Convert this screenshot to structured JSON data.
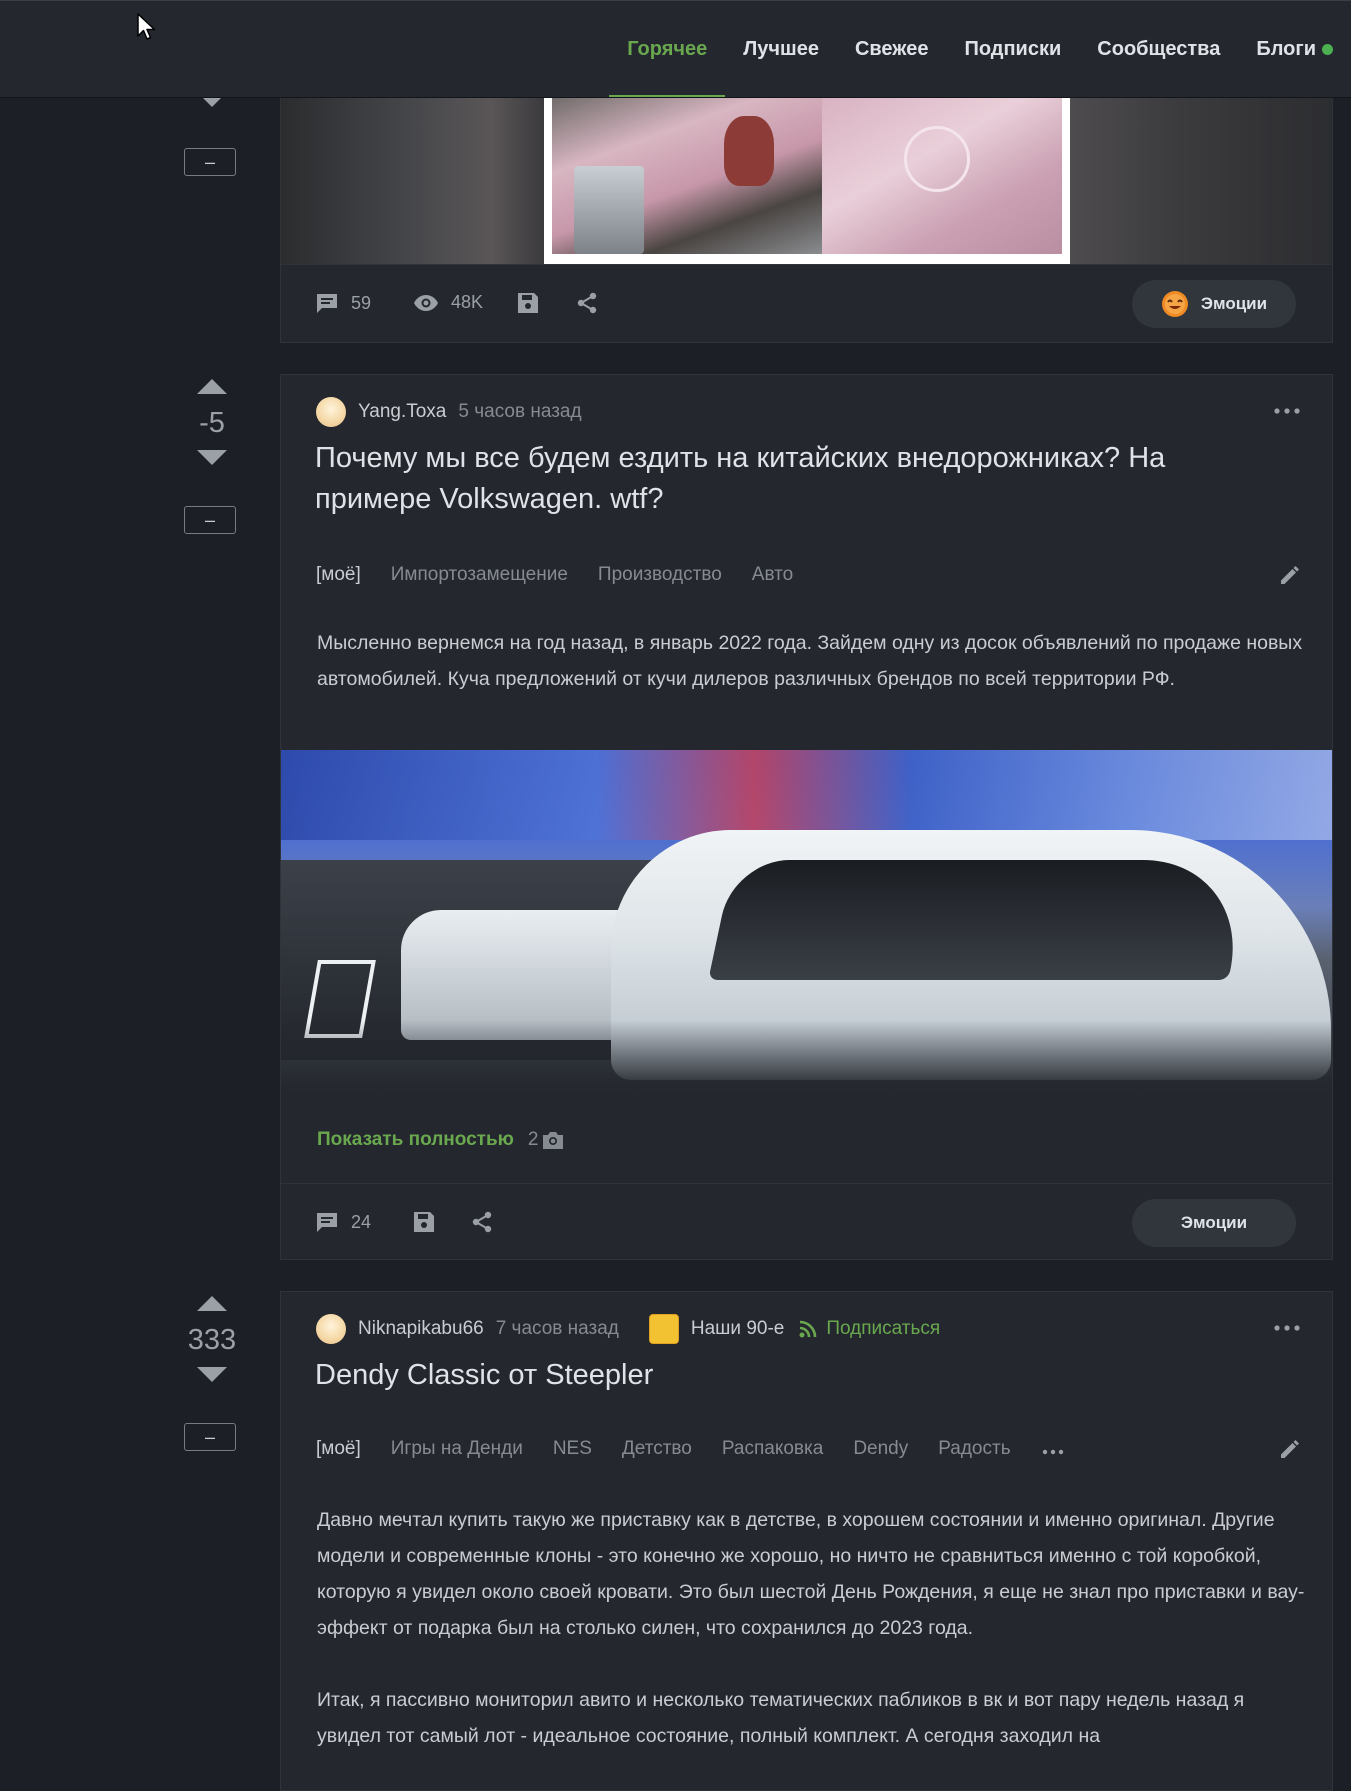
{
  "nav": {
    "items": [
      {
        "label": "Горячее",
        "active": true
      },
      {
        "label": "Лучшее",
        "active": false
      },
      {
        "label": "Свежее",
        "active": false
      },
      {
        "label": "Подписки",
        "active": false
      },
      {
        "label": "Сообщества",
        "active": false
      },
      {
        "label": "Блоги",
        "active": false
      }
    ]
  },
  "collapse_label": "–",
  "emotions_label": "Эмоции",
  "story1": {
    "comments": "59",
    "views": "48K"
  },
  "story2": {
    "rating": "-5",
    "author": "Yang.Toxa",
    "time": "5 часов назад",
    "title": "Почему мы все будем ездить на китайских внедорожниках? На примере Volkswagen. wtf?",
    "tags": [
      "[моё]",
      "Импортозамещение",
      "Производство",
      "Авто"
    ],
    "text": "Мысленно вернемся на год назад, в январь 2022 года. Зайдем одну из досок объявлений по продаже новых автомобилей. Куча предложений от кучи дилеров различных брендов по всей территории РФ.",
    "show_more": "Показать полностью",
    "photo_count": "2",
    "comments": "24"
  },
  "story3": {
    "rating": "333",
    "author": "Niknapikabu66",
    "time": "7 часов назад",
    "community": "Наши 90-е",
    "subscribe": "Подписаться",
    "title": "Dendy Classic от Steepler",
    "tags": [
      "[моё]",
      "Игры на Денди",
      "NES",
      "Детство",
      "Распаковка",
      "Dendy",
      "Радость"
    ],
    "paragraph1": "Давно мечтал купить такую же приставку как в детстве, в хорошем состоянии и именно оригинал. Другие модели и современные клоны - это конечно же хорошо, но ничто не сравниться именно с той коробкой, которую я увидел около своей кровати. Это был шестой День Рождения, я еще не знал про приставки и вау-эффект от подарка был на столько силен, что сохранился до 2023 года.",
    "paragraph2": "Итак, я пассивно мониторил авито и несколько тематических пабликов в вк и вот пару недель назад я увидел тот самый лот - идеальное состояние, полный комплект. А сегодня заходил на"
  },
  "colors": {
    "accent": "#6aa84f",
    "background": "#1c2026",
    "card": "#24282e"
  }
}
